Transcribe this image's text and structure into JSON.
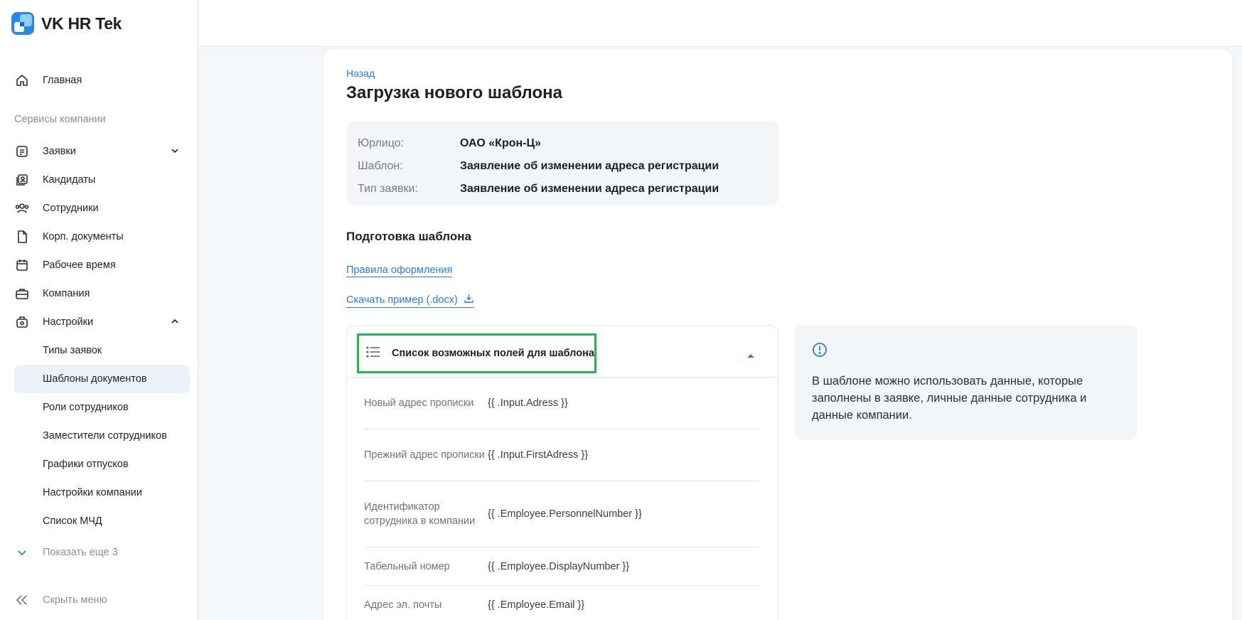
{
  "app": {
    "name": "VK HR Tek"
  },
  "sidebar": {
    "home": "Главная",
    "section_label": "Сервисы компании",
    "items": [
      {
        "label": "Заявки",
        "icon": "requests-icon"
      },
      {
        "label": "Кандидаты",
        "icon": "candidates-icon"
      },
      {
        "label": "Сотрудники",
        "icon": "employees-icon"
      },
      {
        "label": "Корп. документы",
        "icon": "documents-icon"
      },
      {
        "label": "Рабочее время",
        "icon": "calendar-icon"
      },
      {
        "label": "Компания",
        "icon": "briefcase-icon"
      },
      {
        "label": "Настройки",
        "icon": "settings-icon"
      }
    ],
    "settings_sub": [
      {
        "label": "Типы заявок"
      },
      {
        "label": "Шаблоны документов",
        "active": true
      },
      {
        "label": "Роли сотрудников"
      },
      {
        "label": "Заместители сотрудников"
      },
      {
        "label": "Графики отпусков"
      },
      {
        "label": "Настройки компании"
      },
      {
        "label": "Список МЧД"
      }
    ],
    "show_more": "Показать еще 3",
    "hide_menu": "Скрыть меню"
  },
  "main": {
    "back": "Назад",
    "title": "Загрузка нового шаблона",
    "info": [
      {
        "key": "Юрлицо:",
        "value": "ОАО «Крон-Ц»"
      },
      {
        "key": "Шаблон:",
        "value": "Заявление об изменении адреса регистрации"
      },
      {
        "key": "Тип заявки:",
        "value": "Заявление об изменении адреса регистрации"
      }
    ],
    "prep_title": "Подготовка шаблона",
    "rules_link": "Правила оформления",
    "download_link": "Скачать пример (.docx)",
    "fields_title": "Список возможных полей для шаблона",
    "fields": [
      {
        "name": "Новый адрес прописки",
        "value": "{{ .Input.Adress }}"
      },
      {
        "name": "Прежний адрес прописки",
        "value": "{{ .Input.FirstAdress }}"
      },
      {
        "name": "Идентификатор сотрудника в компании",
        "value": "{{ .Employee.PersonnelNumber }}"
      },
      {
        "name": "Табельный номер",
        "value": "{{ .Employee.DisplayNumber }}"
      },
      {
        "name": "Адрес эл. почты",
        "value": "{{ .Employee.Email }}"
      }
    ],
    "hint": "В шаблоне можно использовать данные, которые заполнены в заявке, личные данные сотрудника и данные компании."
  },
  "colors": {
    "accent": "#2a7be4",
    "highlight": "#1fb855",
    "active_bg": "#edf1fb"
  }
}
